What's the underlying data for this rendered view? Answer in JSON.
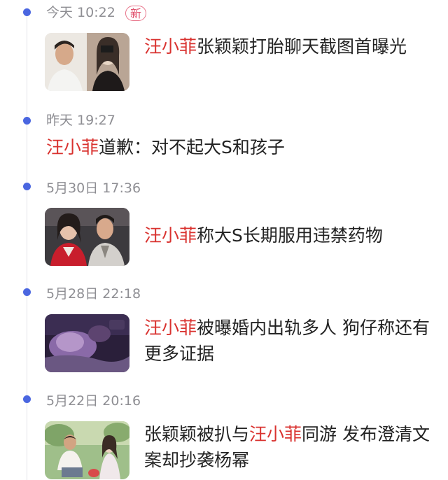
{
  "news": [
    {
      "time": "今天 10:22",
      "badge": "新",
      "highlight": "汪小菲",
      "title_rest": "张颖颖打胎聊天截图首曝光"
    },
    {
      "time": "昨天 19:27",
      "highlight": "汪小菲",
      "title_rest": "道歉：对不起大S和孩子"
    },
    {
      "time": "5月30日 17:36",
      "highlight": "汪小菲",
      "title_rest": "称大S长期服用违禁药物"
    },
    {
      "time": "5月28日 22:18",
      "highlight": "汪小菲",
      "title_rest": "被曝婚内出轨多人 狗仔称还有更多证据"
    },
    {
      "time": "5月22日 20:16",
      "title_before": "张颖颖被扒与",
      "highlight": "汪小菲",
      "title_after": "同游 发布澄清文案却抄袭杨幂"
    }
  ],
  "colors": {
    "timeline_dot": "#4a66e0",
    "highlight": "#d9322f",
    "badge": "#e0506c",
    "time_text": "#8e8e93"
  }
}
